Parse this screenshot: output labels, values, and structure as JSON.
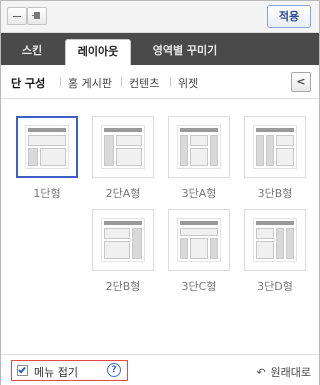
{
  "toolbar": {
    "minimize_icon": "minus-icon",
    "pin_icon": "pin-icon",
    "apply_label": "적용"
  },
  "tabs": [
    {
      "label": "스킨",
      "active": false
    },
    {
      "label": "레이아웃",
      "active": true
    },
    {
      "label": "영역별 꾸미기",
      "active": false
    }
  ],
  "subnav": {
    "items": [
      "단 구성",
      "홈 게시판",
      "컨텐츠",
      "위젯"
    ],
    "active_index": 0,
    "collapse_label": "<"
  },
  "layouts": [
    {
      "label": "1단형",
      "selected": true
    },
    {
      "label": "2단A형",
      "selected": false
    },
    {
      "label": "3단A형",
      "selected": false
    },
    {
      "label": "3단B형",
      "selected": false
    },
    {
      "label": "2단B형",
      "selected": false
    },
    {
      "label": "3단C형",
      "selected": false
    },
    {
      "label": "3단D형",
      "selected": false
    }
  ],
  "footer": {
    "fold_label": "메뉴 접기",
    "fold_checked": true,
    "help_label": "?",
    "reset_label": "원래대로",
    "reset_icon": "undo-icon"
  },
  "colors": {
    "accent": "#3f5ec7",
    "tabbar": "#4a4a4a",
    "highlight_border": "#e24b4b"
  }
}
